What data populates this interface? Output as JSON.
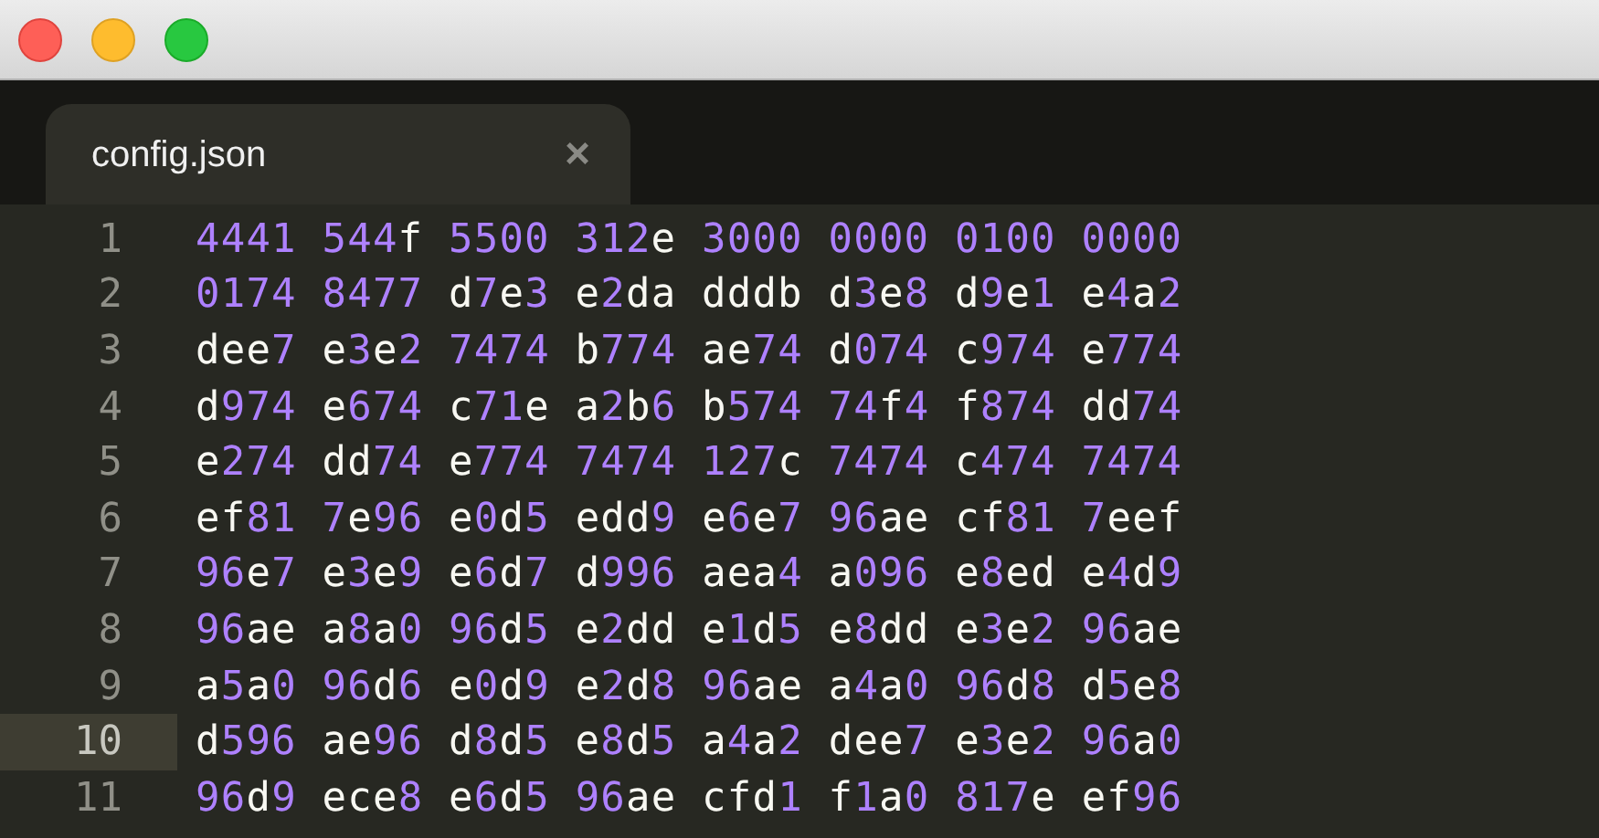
{
  "window": {
    "buttons": [
      {
        "kind": "close"
      },
      {
        "kind": "minimize"
      },
      {
        "kind": "zoom"
      }
    ]
  },
  "tabs": [
    {
      "label": "config.json",
      "close": "×",
      "selected": true
    }
  ],
  "lines": [
    {
      "number": "1",
      "text": "4441 544f 5500 312e 3000 0000 0100 0000",
      "current": false
    },
    {
      "number": "2",
      "text": "0174 8477 d7e3 e2da dddb d3e8 d9e1 e4a2",
      "current": false
    },
    {
      "number": "3",
      "text": "dee7 e3e2 7474 b774 ae74 d074 c974 e774",
      "current": false
    },
    {
      "number": "4",
      "text": "d974 e674 c71e a2b6 b574 74f4 f874 dd74",
      "current": false
    },
    {
      "number": "5",
      "text": "e274 dd74 e774 7474 127c 7474 c474 7474",
      "current": false
    },
    {
      "number": "6",
      "text": "ef81 7e96 e0d5 edd9 e6e7 96ae cf81 7eef",
      "current": false
    },
    {
      "number": "7",
      "text": "96e7 e3e9 e6d7 d996 aea4 a096 e8ed e4d9",
      "current": false
    },
    {
      "number": "8",
      "text": "96ae a8a0 96d5 e2dd e1d5 e8dd e3e2 96ae",
      "current": false
    },
    {
      "number": "9",
      "text": "a5a0 96d6 e0d9 e2d8 96ae a4a0 96d8 d5e8",
      "current": false
    },
    {
      "number": "10",
      "text": "d596 ae96 d8d5 e8d5 a4a2 dee7 e3e2 96a0",
      "current": true
    },
    {
      "number": "11",
      "text": "96d9 ece8 e6d5 96ae cfd1 f1a0 817e ef96",
      "current": false
    }
  ]
}
